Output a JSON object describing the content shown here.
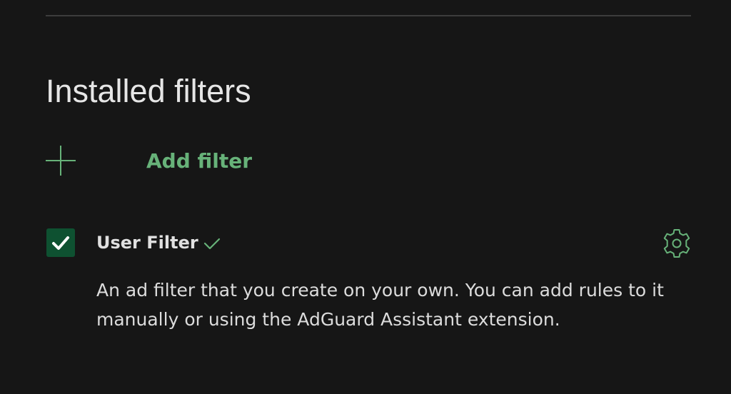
{
  "section": {
    "title": "Installed filters"
  },
  "add_filter": {
    "icon": "plus-icon",
    "label": "Add filter"
  },
  "filters": [
    {
      "name": "User Filter",
      "enabled": true,
      "status_icon": "check-icon",
      "settings_icon": "gear-icon",
      "description": "An ad filter that you create on your own. You can add rules to it manually or using the AdGuard Assistant extension."
    }
  ],
  "colors": {
    "background": "#161616",
    "accent_green": "#67b279",
    "checkbox_fill": "#0e5131",
    "divider": "#3c3c3c",
    "text_primary": "#e0e0e0"
  }
}
